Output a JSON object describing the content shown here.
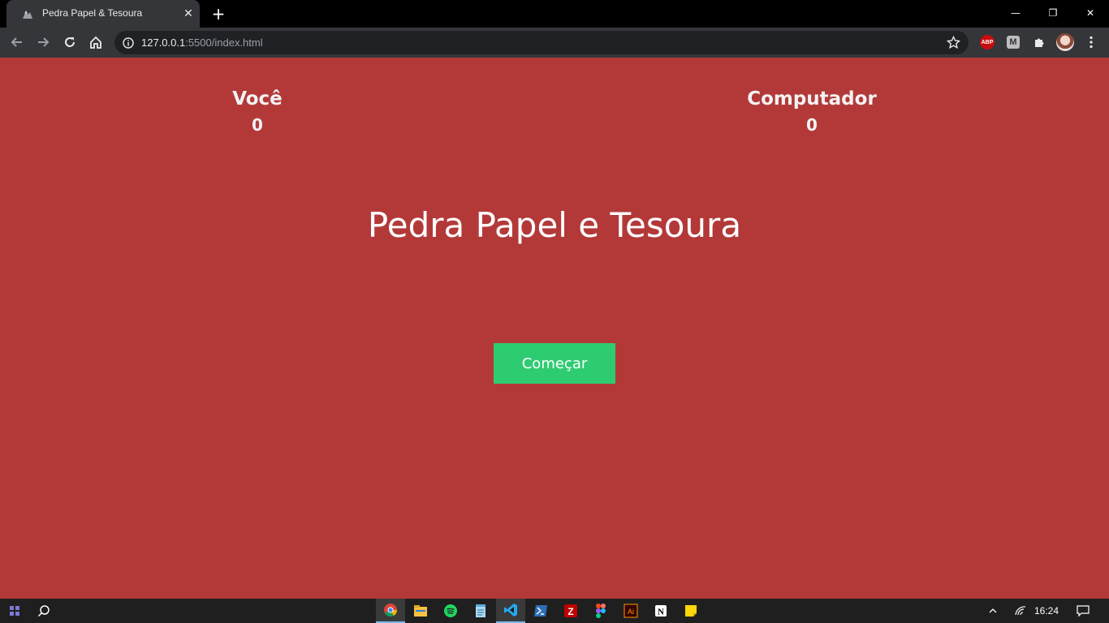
{
  "browser": {
    "tab": {
      "title": "Pedra Papel & Tesoura",
      "favicon": "rocks-icon"
    },
    "url": {
      "host": "127.0.0.1",
      "path": ":5500/index.html"
    },
    "extensions": {
      "abp_label": "ABP",
      "m_label": "M"
    },
    "window_controls": {
      "minimize": "—",
      "maximize": "❐",
      "close": "✕"
    }
  },
  "game": {
    "player_label": "Você",
    "player_score": "0",
    "computer_label": "Computador",
    "computer_score": "0",
    "title": "Pedra Papel e Tesoura",
    "start_label": "Começar"
  },
  "taskbar": {
    "time": "16:24",
    "apps": [
      "chrome-icon",
      "file-explorer-icon",
      "spotify-icon",
      "notepad-icon",
      "vscode-icon",
      "powershell-icon",
      "filezilla-icon",
      "figma-icon",
      "illustrator-icon",
      "notion-icon",
      "sticky-notes-icon"
    ]
  },
  "colors": {
    "page_bg": "#b33939",
    "button_bg": "#2ecc71",
    "chrome_bg": "#35363a"
  }
}
